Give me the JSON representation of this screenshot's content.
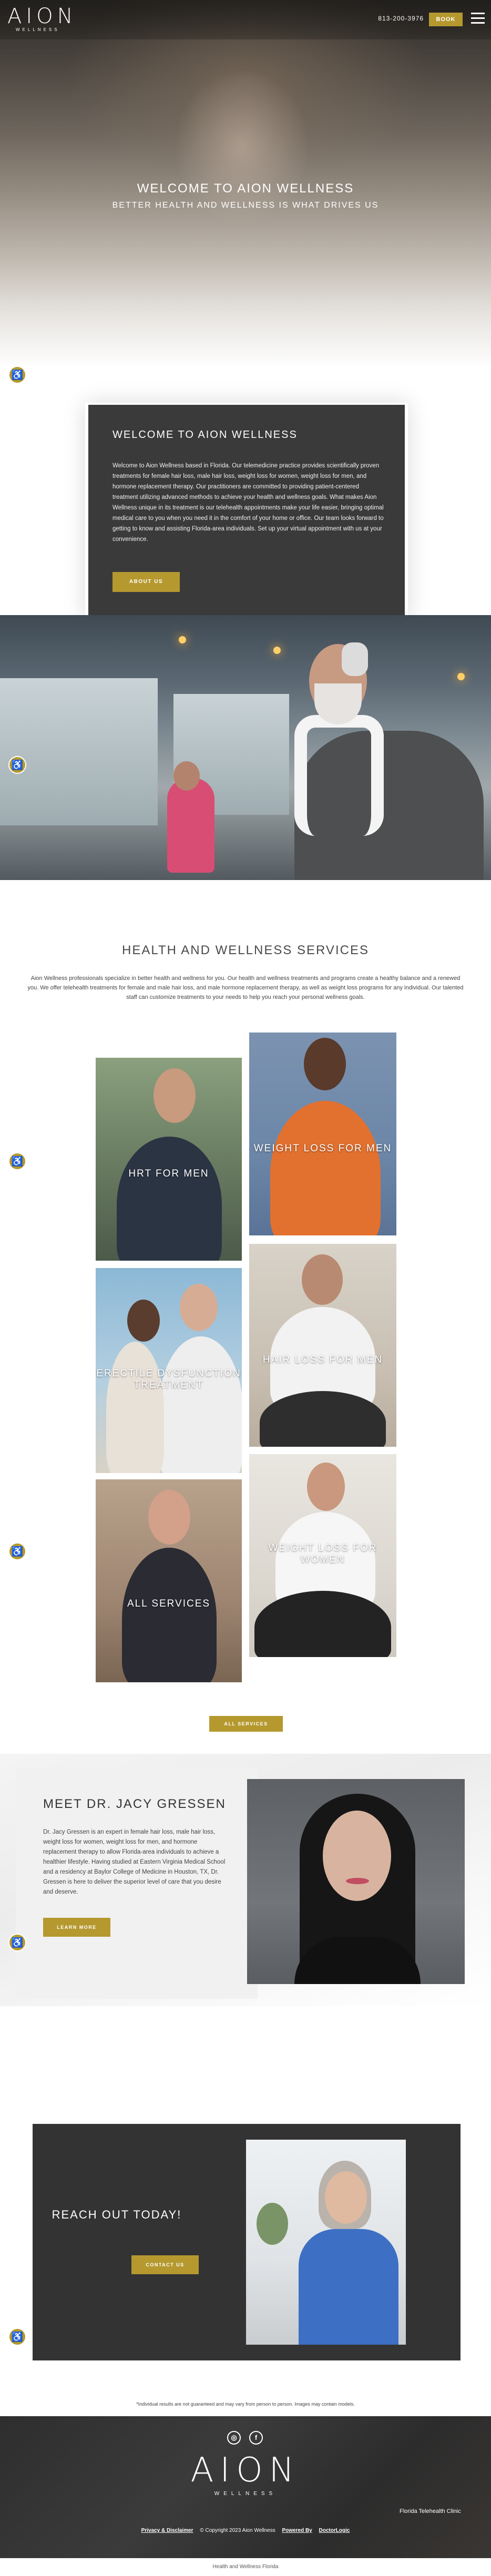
{
  "header": {
    "logo": "AION",
    "logo_sub": "WELLNESS",
    "phone": "813-200-3976",
    "book_label": "BOOK"
  },
  "hero": {
    "title": "WELCOME TO AION WELLNESS",
    "subtitle": "BETTER HEALTH AND WELLNESS IS WHAT DRIVES US"
  },
  "welcome": {
    "title": "WELCOME TO AION WELLNESS",
    "body": "Welcome to Aion Wellness based in Florida. Our telemedicine practice provides scientifically proven treatments for female hair loss, male hair loss, weight loss for women, weight loss for men, and hormone replacement therapy. Our practitioners are committed to providing patient-centered treatment utilizing advanced methods to achieve your health and wellness goals. What makes Aion Wellness unique in its treatment is our telehealth appointments make your life easier, bringing optimal medical care to you when you need it in the comfort of your home or office. Our team looks forward to getting to know and assisting Florida-area individuals. Set up your virtual appointment with us at your convenience.",
    "button": "ABOUT US"
  },
  "services": {
    "title": "HEALTH AND WELLNESS SERVICES",
    "intro": "Aion Wellness professionals specialize in better health and wellness for you. Our health and wellness treatments and programs create a healthy balance and a renewed you. We offer telehealth treatments for female and male hair loss, and male hormone replacement therapy, as well as weight loss programs for any individual. Our talented staff can customize treatments to your needs to help you reach your personal wellness goals.",
    "tiles": [
      {
        "label": "HRT FOR MEN"
      },
      {
        "label": "WEIGHT LOSS FOR MEN"
      },
      {
        "label": "ERECTILE DYSFUNCTION TREATMENT"
      },
      {
        "label": "HAIR LOSS FOR MEN"
      },
      {
        "label": "ALL SERVICES"
      },
      {
        "label": "WEIGHT LOSS FOR WOMEN"
      }
    ],
    "button": "ALL SERVICES"
  },
  "meet": {
    "title": "MEET DR. JACY GRESSEN",
    "body": "Dr. Jacy Gressen is an expert in female hair loss, male hair loss, weight loss for women, weight loss for men, and hormone replacement therapy to allow Florida-area individuals to achieve a healthier lifestyle. Having studied at Eastern Virginia Medical School and a residency at Baylor College of Medicine in Houston, TX, Dr. Gressen is here to deliver the superior level of care that you desire and deserve.",
    "button": "LEARN MORE"
  },
  "reach": {
    "title": "REACH OUT TODAY!",
    "button": "CONTACT US"
  },
  "disclaimer": "*Individual results are not guaranteed and may vary from person to person. Images may contain models.",
  "footer": {
    "social": [
      {
        "icon": "instagram-icon",
        "glyph": "◎"
      },
      {
        "icon": "facebook-icon",
        "glyph": "f"
      }
    ],
    "logo": "AION",
    "logo_sub": "WELLNESS",
    "clinic": "Florida Telehealth Clinic",
    "privacy": "Privacy & Disclaimer",
    "copyright": "© Copyright 2023 Aion Wellness",
    "powered_by": "Powered By",
    "powered_brand": "DoctorLogic",
    "bottom": "Health and Wellness Florida"
  },
  "accessibility_glyph": "♿",
  "colors": {
    "accent_gold": "#b5992f",
    "dark_card": "#3a3a3a",
    "footer_dark": "#2e2e2e"
  }
}
